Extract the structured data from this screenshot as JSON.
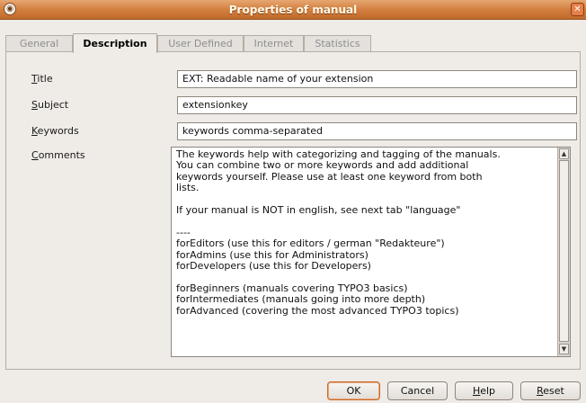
{
  "window": {
    "title": "Properties of manual",
    "close_glyph": "✕",
    "app_glyph": "◉"
  },
  "tabs": [
    {
      "label": "General",
      "active": false
    },
    {
      "label": "Description",
      "active": true
    },
    {
      "label": "User Defined",
      "active": false
    },
    {
      "label": "Internet",
      "active": false
    },
    {
      "label": "Statistics",
      "active": false
    }
  ],
  "form": {
    "title": {
      "mnemonic": "T",
      "rest": "itle",
      "value": "EXT: Readable name of your extension"
    },
    "subject": {
      "mnemonic": "S",
      "rest": "ubject",
      "value": "extensionkey"
    },
    "keywords": {
      "mnemonic": "K",
      "rest": "eywords",
      "value": "keywords comma-separated"
    },
    "comments": {
      "mnemonic": "C",
      "rest": "omments",
      "value": "The keywords help with categorizing and tagging of the manuals.\nYou can combine two or more keywords and add additional\nkeywords yourself. Please use at least one keyword from both\nlists.\n\nIf your manual is NOT in english, see next tab \"language\"\n\n----\nforEditors (use this for editors / german \"Redakteure\")\nforAdmins (use this for Administrators)\nforDevelopers (use this for Developers)\n\nforBeginners (manuals covering TYPO3 basics)\nforIntermediates (manuals going into more depth)\nforAdvanced (covering the most advanced TYPO3 topics)"
    }
  },
  "buttons": {
    "ok": "OK",
    "cancel": "Cancel",
    "help": {
      "mnemonic": "H",
      "rest": "elp"
    },
    "reset": {
      "mnemonic": "R",
      "rest": "eset"
    }
  }
}
